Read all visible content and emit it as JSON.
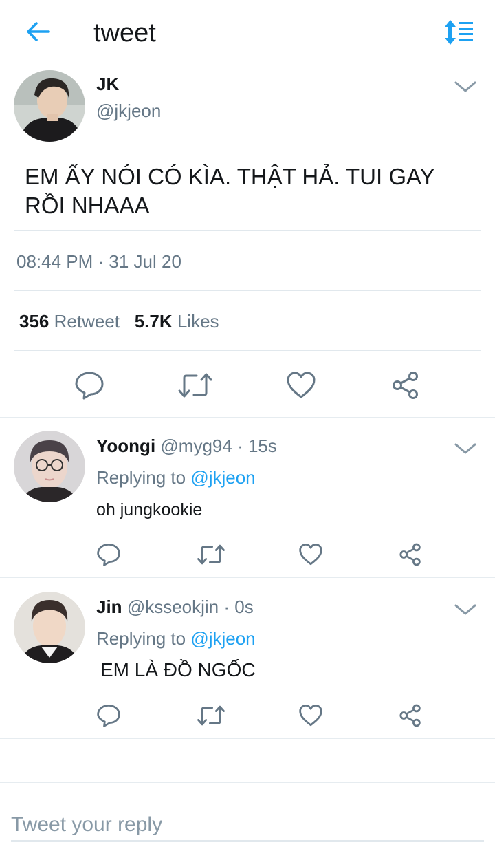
{
  "header": {
    "title": "tweet",
    "back_icon": "arrow-left-icon",
    "sort_icon": "sort-list-icon",
    "accent": "#1da1f2"
  },
  "tweet": {
    "name": "JK",
    "handle": "@jkjeon",
    "text": "EM ẤY NÓI CÓ KÌA. THẬT HẢ. TUI GAY RỒI NHAAA",
    "time": "08:44 PM · 31 Jul 20",
    "retweets": "356",
    "retweets_label": "Retweet",
    "likes": "5.7K",
    "likes_label": "Likes"
  },
  "replies": [
    {
      "name": "Yoongi",
      "handle": "@myg94",
      "age": "· 15s",
      "replying_label": "Replying to",
      "replying_to": "@jkjeon",
      "text": "oh jungkookie"
    },
    {
      "name": "Jin",
      "handle": "@ksseokjin",
      "age": "· 0s",
      "replying_label": "Replying to",
      "replying_to": "@jkjeon",
      "text": "EM LÀ ĐỒ NGỐC"
    }
  ],
  "composer": {
    "placeholder": "Tweet your reply"
  },
  "colors": {
    "text": "#14171a",
    "secondary": "#657786",
    "link": "#1da1f2",
    "divider": "#e1e8ed"
  }
}
